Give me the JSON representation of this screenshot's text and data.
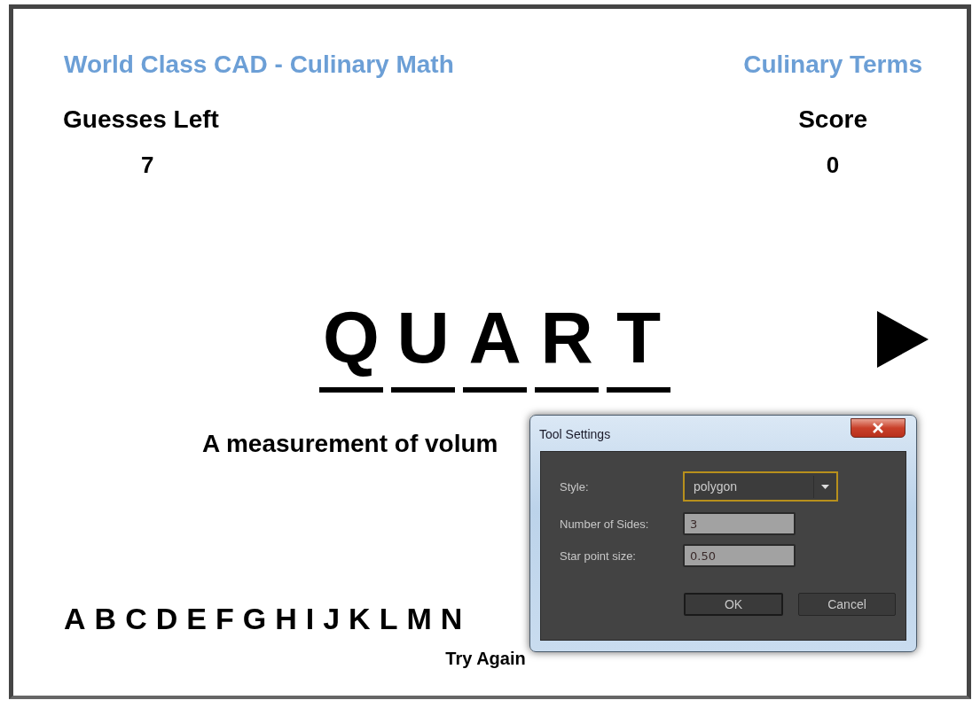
{
  "header": {
    "title": "World Class CAD - Culinary Math",
    "category": "Culinary Terms"
  },
  "guesses": {
    "label": "Guesses Left",
    "value": "7"
  },
  "score": {
    "label": "Score",
    "value": "0"
  },
  "word": [
    {
      "letter": "Q"
    },
    {
      "letter": "U"
    },
    {
      "letter": "A"
    },
    {
      "letter": "R"
    },
    {
      "letter": "T"
    }
  ],
  "clue": "A measurement of volum",
  "alphabet": [
    "A",
    "B",
    "C",
    "D",
    "E",
    "F",
    "G",
    "H",
    "I",
    "J",
    "K",
    "L",
    "M",
    "N"
  ],
  "try_again": "Try Again",
  "dialog": {
    "title": "Tool Settings",
    "fields": [
      {
        "kind": "select",
        "label": "Style:",
        "value": "polygon"
      },
      {
        "kind": "text",
        "label": "Number of Sides:",
        "value": "3"
      },
      {
        "kind": "text",
        "label": "Star point size:",
        "value": "0.50"
      }
    ],
    "buttons": [
      "OK",
      "Cancel"
    ]
  }
}
